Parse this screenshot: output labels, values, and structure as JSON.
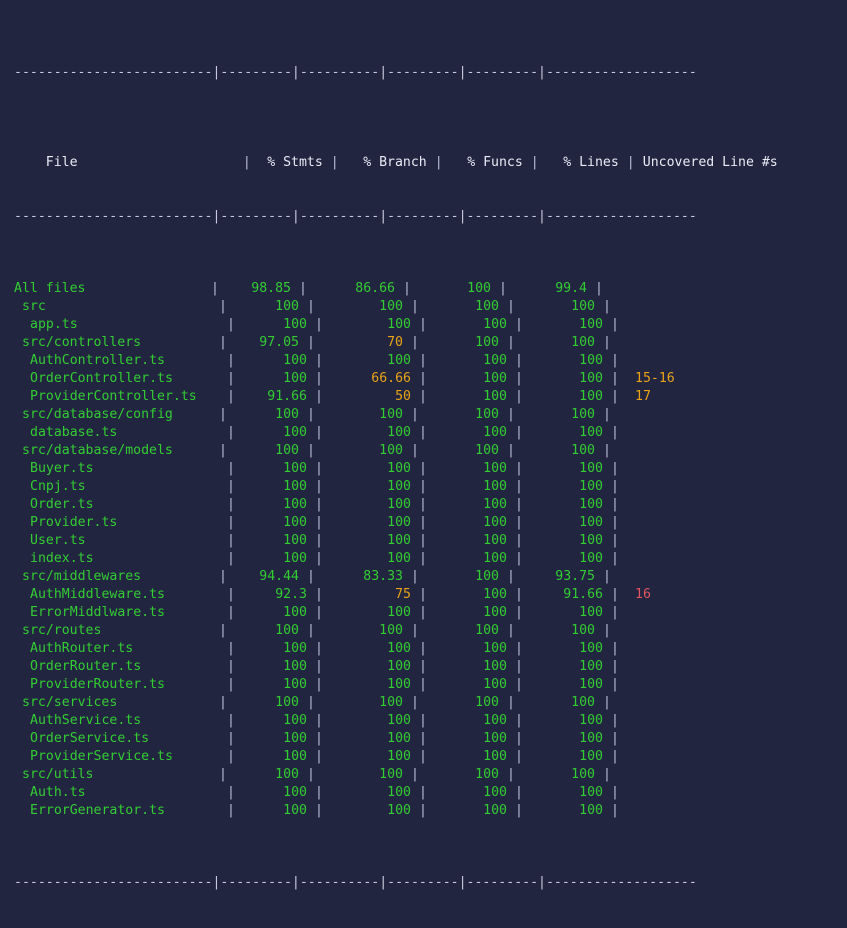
{
  "terminal": {
    "kind": "coverage-report-table",
    "background_color": "#222540",
    "colors": {
      "green": "#33cc33",
      "yellow": "#e8a317",
      "red": "#e05561",
      "rule": "#c8cbe0",
      "header_text": "#e8eaf5"
    },
    "rules": {
      "top": "-------------------------|---------|----------|---------|---------|-------------------",
      "header": "-------------------------|---------|----------|---------|---------|-------------------",
      "bottom": "-------------------------|---------|----------|---------|---------|-------------------"
    },
    "rule_segments": {
      "file": "-------------------------",
      "stmts": "---------",
      "branch": "----------",
      "funcs": "---------",
      "lines": "---------",
      "uncovered": "-------------------",
      "pipe": "|"
    },
    "header": {
      "file": "File",
      "stmts": "% Stmts",
      "branch": "% Branch",
      "funcs": "% Funcs",
      "lines": "% Lines",
      "uncovered": "Uncovered Line #s"
    },
    "rows": [
      {
        "name": "All files",
        "indent": 0,
        "name_color": "green",
        "stmts": "98.85",
        "stmts_color": "green",
        "branch": "86.66",
        "branch_color": "green",
        "funcs": "100",
        "funcs_color": "green",
        "lines": "99.4",
        "lines_color": "green",
        "uncovered": "",
        "uncovered_color": "green"
      },
      {
        "name": "src",
        "indent": 1,
        "name_color": "green",
        "stmts": "100",
        "stmts_color": "green",
        "branch": "100",
        "branch_color": "green",
        "funcs": "100",
        "funcs_color": "green",
        "lines": "100",
        "lines_color": "green",
        "uncovered": "",
        "uncovered_color": "green"
      },
      {
        "name": "app.ts",
        "indent": 2,
        "name_color": "green",
        "stmts": "100",
        "stmts_color": "green",
        "branch": "100",
        "branch_color": "green",
        "funcs": "100",
        "funcs_color": "green",
        "lines": "100",
        "lines_color": "green",
        "uncovered": "",
        "uncovered_color": "green"
      },
      {
        "name": "src/controllers",
        "indent": 1,
        "name_color": "green",
        "stmts": "97.05",
        "stmts_color": "green",
        "branch": "70",
        "branch_color": "yellow",
        "funcs": "100",
        "funcs_color": "green",
        "lines": "100",
        "lines_color": "green",
        "uncovered": "",
        "uncovered_color": "yellow"
      },
      {
        "name": "AuthController.ts",
        "indent": 2,
        "name_color": "green",
        "stmts": "100",
        "stmts_color": "green",
        "branch": "100",
        "branch_color": "green",
        "funcs": "100",
        "funcs_color": "green",
        "lines": "100",
        "lines_color": "green",
        "uncovered": "",
        "uncovered_color": "green"
      },
      {
        "name": "OrderController.ts",
        "indent": 2,
        "name_color": "green",
        "stmts": "100",
        "stmts_color": "green",
        "branch": "66.66",
        "branch_color": "yellow",
        "funcs": "100",
        "funcs_color": "green",
        "lines": "100",
        "lines_color": "green",
        "uncovered": "15-16",
        "uncovered_color": "yellow"
      },
      {
        "name": "ProviderController.ts",
        "indent": 2,
        "name_color": "green",
        "stmts": "91.66",
        "stmts_color": "green",
        "branch": "50",
        "branch_color": "yellow",
        "funcs": "100",
        "funcs_color": "green",
        "lines": "100",
        "lines_color": "green",
        "uncovered": "17",
        "uncovered_color": "yellow"
      },
      {
        "name": "src/database/config",
        "indent": 1,
        "name_color": "green",
        "stmts": "100",
        "stmts_color": "green",
        "branch": "100",
        "branch_color": "green",
        "funcs": "100",
        "funcs_color": "green",
        "lines": "100",
        "lines_color": "green",
        "uncovered": "",
        "uncovered_color": "green"
      },
      {
        "name": "database.ts",
        "indent": 2,
        "name_color": "green",
        "stmts": "100",
        "stmts_color": "green",
        "branch": "100",
        "branch_color": "green",
        "funcs": "100",
        "funcs_color": "green",
        "lines": "100",
        "lines_color": "green",
        "uncovered": "",
        "uncovered_color": "green"
      },
      {
        "name": "src/database/models",
        "indent": 1,
        "name_color": "green",
        "stmts": "100",
        "stmts_color": "green",
        "branch": "100",
        "branch_color": "green",
        "funcs": "100",
        "funcs_color": "green",
        "lines": "100",
        "lines_color": "green",
        "uncovered": "",
        "uncovered_color": "green"
      },
      {
        "name": "Buyer.ts",
        "indent": 2,
        "name_color": "green",
        "stmts": "100",
        "stmts_color": "green",
        "branch": "100",
        "branch_color": "green",
        "funcs": "100",
        "funcs_color": "green",
        "lines": "100",
        "lines_color": "green",
        "uncovered": "",
        "uncovered_color": "green"
      },
      {
        "name": "Cnpj.ts",
        "indent": 2,
        "name_color": "green",
        "stmts": "100",
        "stmts_color": "green",
        "branch": "100",
        "branch_color": "green",
        "funcs": "100",
        "funcs_color": "green",
        "lines": "100",
        "lines_color": "green",
        "uncovered": "",
        "uncovered_color": "green"
      },
      {
        "name": "Order.ts",
        "indent": 2,
        "name_color": "green",
        "stmts": "100",
        "stmts_color": "green",
        "branch": "100",
        "branch_color": "green",
        "funcs": "100",
        "funcs_color": "green",
        "lines": "100",
        "lines_color": "green",
        "uncovered": "",
        "uncovered_color": "green"
      },
      {
        "name": "Provider.ts",
        "indent": 2,
        "name_color": "green",
        "stmts": "100",
        "stmts_color": "green",
        "branch": "100",
        "branch_color": "green",
        "funcs": "100",
        "funcs_color": "green",
        "lines": "100",
        "lines_color": "green",
        "uncovered": "",
        "uncovered_color": "green"
      },
      {
        "name": "User.ts",
        "indent": 2,
        "name_color": "green",
        "stmts": "100",
        "stmts_color": "green",
        "branch": "100",
        "branch_color": "green",
        "funcs": "100",
        "funcs_color": "green",
        "lines": "100",
        "lines_color": "green",
        "uncovered": "",
        "uncovered_color": "green"
      },
      {
        "name": "index.ts",
        "indent": 2,
        "name_color": "green",
        "stmts": "100",
        "stmts_color": "green",
        "branch": "100",
        "branch_color": "green",
        "funcs": "100",
        "funcs_color": "green",
        "lines": "100",
        "lines_color": "green",
        "uncovered": "",
        "uncovered_color": "green"
      },
      {
        "name": "src/middlewares",
        "indent": 1,
        "name_color": "green",
        "stmts": "94.44",
        "stmts_color": "green",
        "branch": "83.33",
        "branch_color": "green",
        "funcs": "100",
        "funcs_color": "green",
        "lines": "93.75",
        "lines_color": "green",
        "uncovered": "",
        "uncovered_color": "red"
      },
      {
        "name": "AuthMiddleware.ts",
        "indent": 2,
        "name_color": "green",
        "stmts": "92.3",
        "stmts_color": "green",
        "branch": "75",
        "branch_color": "yellow",
        "funcs": "100",
        "funcs_color": "green",
        "lines": "91.66",
        "lines_color": "green",
        "uncovered": "16",
        "uncovered_color": "red"
      },
      {
        "name": "ErrorMiddlware.ts",
        "indent": 2,
        "name_color": "green",
        "stmts": "100",
        "stmts_color": "green",
        "branch": "100",
        "branch_color": "green",
        "funcs": "100",
        "funcs_color": "green",
        "lines": "100",
        "lines_color": "green",
        "uncovered": "",
        "uncovered_color": "green"
      },
      {
        "name": "src/routes",
        "indent": 1,
        "name_color": "green",
        "stmts": "100",
        "stmts_color": "green",
        "branch": "100",
        "branch_color": "green",
        "funcs": "100",
        "funcs_color": "green",
        "lines": "100",
        "lines_color": "green",
        "uncovered": "",
        "uncovered_color": "green"
      },
      {
        "name": "AuthRouter.ts",
        "indent": 2,
        "name_color": "green",
        "stmts": "100",
        "stmts_color": "green",
        "branch": "100",
        "branch_color": "green",
        "funcs": "100",
        "funcs_color": "green",
        "lines": "100",
        "lines_color": "green",
        "uncovered": "",
        "uncovered_color": "green"
      },
      {
        "name": "OrderRouter.ts",
        "indent": 2,
        "name_color": "green",
        "stmts": "100",
        "stmts_color": "green",
        "branch": "100",
        "branch_color": "green",
        "funcs": "100",
        "funcs_color": "green",
        "lines": "100",
        "lines_color": "green",
        "uncovered": "",
        "uncovered_color": "green"
      },
      {
        "name": "ProviderRouter.ts",
        "indent": 2,
        "name_color": "green",
        "stmts": "100",
        "stmts_color": "green",
        "branch": "100",
        "branch_color": "green",
        "funcs": "100",
        "funcs_color": "green",
        "lines": "100",
        "lines_color": "green",
        "uncovered": "",
        "uncovered_color": "green"
      },
      {
        "name": "src/services",
        "indent": 1,
        "name_color": "green",
        "stmts": "100",
        "stmts_color": "green",
        "branch": "100",
        "branch_color": "green",
        "funcs": "100",
        "funcs_color": "green",
        "lines": "100",
        "lines_color": "green",
        "uncovered": "",
        "uncovered_color": "green"
      },
      {
        "name": "AuthService.ts",
        "indent": 2,
        "name_color": "green",
        "stmts": "100",
        "stmts_color": "green",
        "branch": "100",
        "branch_color": "green",
        "funcs": "100",
        "funcs_color": "green",
        "lines": "100",
        "lines_color": "green",
        "uncovered": "",
        "uncovered_color": "green"
      },
      {
        "name": "OrderService.ts",
        "indent": 2,
        "name_color": "green",
        "stmts": "100",
        "stmts_color": "green",
        "branch": "100",
        "branch_color": "green",
        "funcs": "100",
        "funcs_color": "green",
        "lines": "100",
        "lines_color": "green",
        "uncovered": "",
        "uncovered_color": "green"
      },
      {
        "name": "ProviderService.ts",
        "indent": 2,
        "name_color": "green",
        "stmts": "100",
        "stmts_color": "green",
        "branch": "100",
        "branch_color": "green",
        "funcs": "100",
        "funcs_color": "green",
        "lines": "100",
        "lines_color": "green",
        "uncovered": "",
        "uncovered_color": "green"
      },
      {
        "name": "src/utils",
        "indent": 1,
        "name_color": "green",
        "stmts": "100",
        "stmts_color": "green",
        "branch": "100",
        "branch_color": "green",
        "funcs": "100",
        "funcs_color": "green",
        "lines": "100",
        "lines_color": "green",
        "uncovered": "",
        "uncovered_color": "green"
      },
      {
        "name": "Auth.ts",
        "indent": 2,
        "name_color": "green",
        "stmts": "100",
        "stmts_color": "green",
        "branch": "100",
        "branch_color": "green",
        "funcs": "100",
        "funcs_color": "green",
        "lines": "100",
        "lines_color": "green",
        "uncovered": "",
        "uncovered_color": "green"
      },
      {
        "name": "ErrorGenerator.ts",
        "indent": 2,
        "name_color": "green",
        "stmts": "100",
        "stmts_color": "green",
        "branch": "100",
        "branch_color": "green",
        "funcs": "100",
        "funcs_color": "green",
        "lines": "100",
        "lines_color": "green",
        "uncovered": "",
        "uncovered_color": "green"
      }
    ]
  }
}
